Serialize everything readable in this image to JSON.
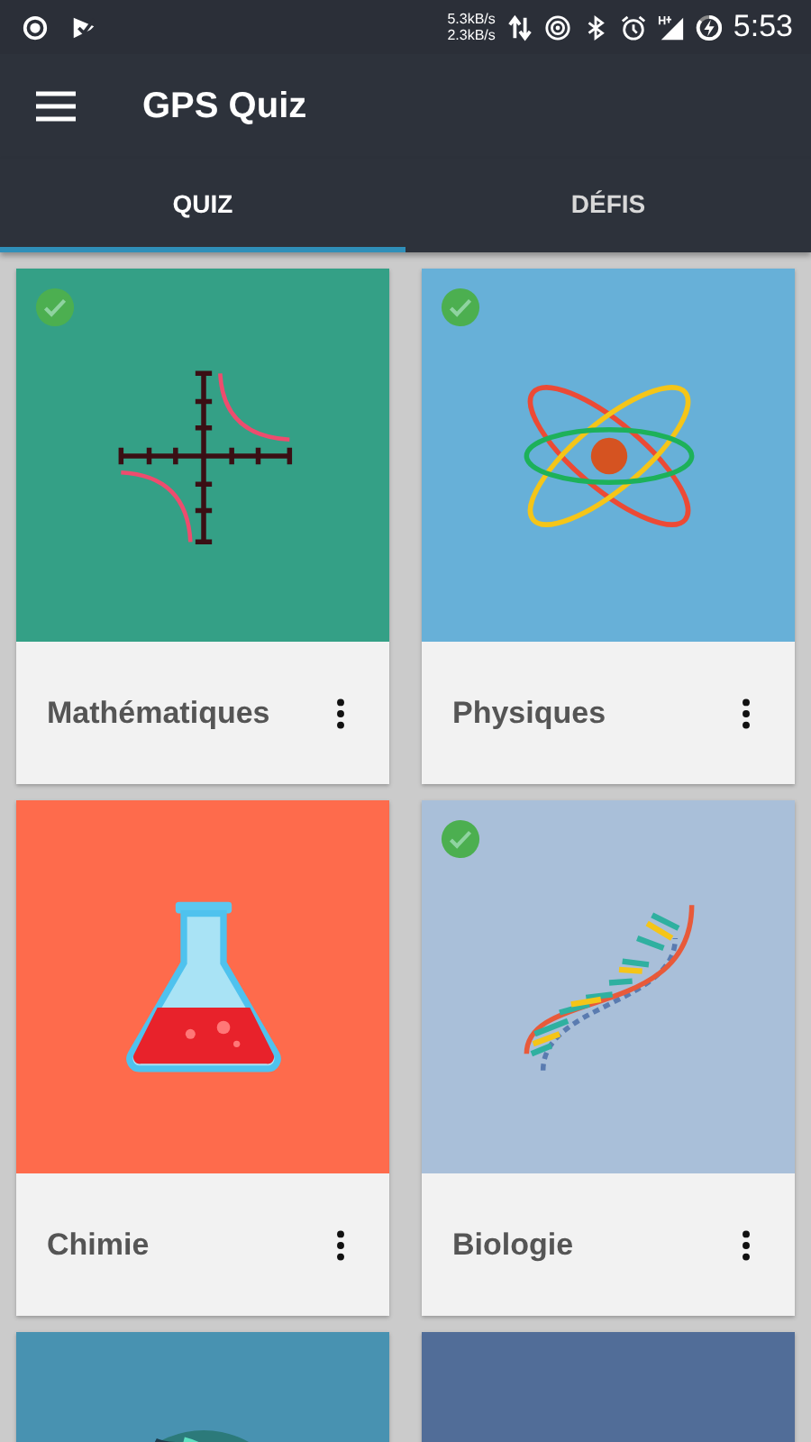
{
  "status_bar": {
    "upload_speed": "5.3kB/s",
    "download_speed": "2.3kB/s",
    "time": "5:53"
  },
  "app_bar": {
    "title": "GPS Quiz"
  },
  "tabs": [
    {
      "label": "QUIZ",
      "selected": true
    },
    {
      "label": "DÉFIS",
      "selected": false
    }
  ],
  "cards": [
    {
      "title": "Mathématiques",
      "kind": "math",
      "color": "#34a086",
      "completed": true
    },
    {
      "title": "Physiques",
      "kind": "physics",
      "color": "#67b0d8",
      "completed": true
    },
    {
      "title": "Chimie",
      "kind": "chemistry",
      "color": "#fe6b4c",
      "completed": false
    },
    {
      "title": "Biologie",
      "kind": "biology",
      "color": "#a9bfd9",
      "completed": true
    },
    {
      "kind": "globe",
      "color": "#4892b1",
      "completed": false
    },
    {
      "kind": "blank",
      "color": "#516d98",
      "completed": false
    }
  ]
}
